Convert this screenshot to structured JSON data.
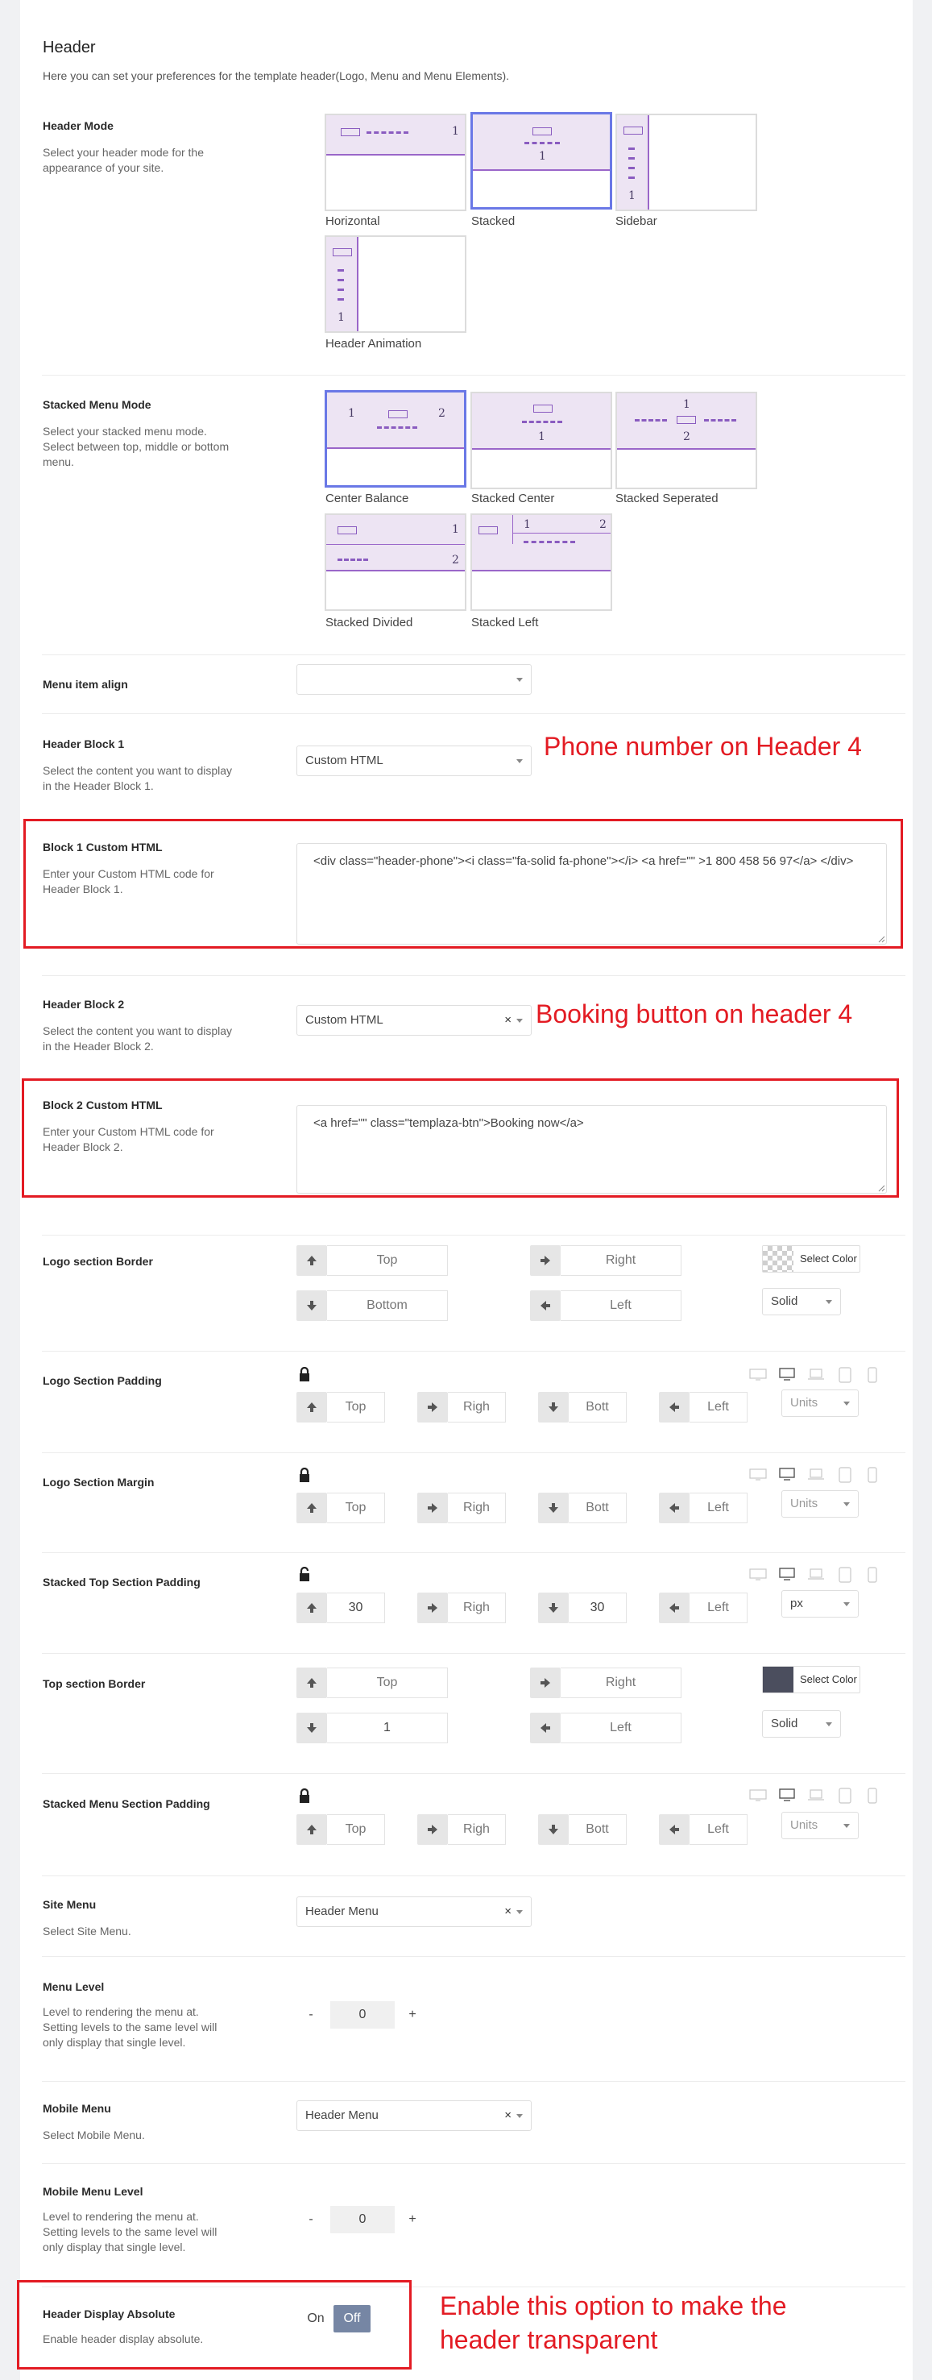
{
  "header": {
    "title": "Header",
    "description": "Here you can set your preferences for the template header(Logo, Menu and Menu Elements)."
  },
  "header_mode": {
    "label": "Header Mode",
    "description": "Select your header mode for the appearance of your site.",
    "options": [
      "Horizontal",
      "Stacked",
      "Sidebar",
      "Header Animation"
    ],
    "selected": "Stacked"
  },
  "stacked_menu_mode": {
    "label": "Stacked Menu Mode",
    "description": "Select your stacked menu mode. Select between top, middle or bottom menu.",
    "options": [
      "Center Balance",
      "Stacked Center",
      "Stacked Seperated",
      "Stacked Divided",
      "Stacked Left"
    ],
    "selected": "Center Balance"
  },
  "tile_numbers": {
    "one": "1",
    "two": "2"
  },
  "menu_item_align": {
    "label": "Menu item align",
    "value": ""
  },
  "header_block_1": {
    "label": "Header Block 1",
    "description": "Select the content you want to display in the Header Block 1.",
    "value": "Custom HTML"
  },
  "block_1_html": {
    "label": "Block 1 Custom HTML",
    "description": "Enter your Custom HTML code for Header Block 1.",
    "value": "<div class=\"header-phone\"><i class=\"fa-solid fa-phone\"></i>  <a href=\"\" >1 800 458 56 97</a> </div>"
  },
  "header_block_2": {
    "label": "Header Block 2",
    "description": "Select the content you want to display in the Header Block 2.",
    "value": "Custom HTML",
    "clear": "×"
  },
  "block_2_html": {
    "label": "Block 2 Custom HTML",
    "description": "Enter your Custom HTML code for Header Block 2.",
    "value": "<a href=\"\" class=\"templaza-btn\">Booking now</a>"
  },
  "annotations": {
    "phone": "Phone number on Header 4",
    "booking": "Booking button on header 4",
    "transparent_line1": "Enable this option to make the",
    "transparent_line2": "header transparent"
  },
  "logo_section_border": {
    "label": "Logo section Border",
    "top": "Top",
    "right": "Right",
    "bottom": "Bottom",
    "left": "Left",
    "color_label": "Select Color",
    "style": "Solid"
  },
  "logo_section_padding": {
    "label": "Logo Section Padding",
    "top": "Top",
    "right": "Righ",
    "bottom": "Bott",
    "left": "Left",
    "units": "Units"
  },
  "logo_section_margin": {
    "label": "Logo Section Margin",
    "top": "Top",
    "right": "Righ",
    "bottom": "Bott",
    "left": "Left",
    "units": "Units"
  },
  "stacked_top_padding": {
    "label": "Stacked Top Section Padding",
    "top": "30",
    "right": "Righ",
    "bottom": "30",
    "left": "Left",
    "units": "px"
  },
  "top_section_border": {
    "label": "Top section Border",
    "top": "Top",
    "right": "Right",
    "bottom": "1",
    "left": "Left",
    "color_label": "Select Color",
    "color": "#4b4e5e",
    "style": "Solid"
  },
  "stacked_menu_padding": {
    "label": "Stacked Menu Section Padding",
    "top": "Top",
    "right": "Righ",
    "bottom": "Bott",
    "left": "Left",
    "units": "Units"
  },
  "site_menu": {
    "label": "Site Menu",
    "description": "Select Site Menu.",
    "value": "Header Menu",
    "clear": "×"
  },
  "menu_level": {
    "label": "Menu Level",
    "description": "Level to rendering the menu at. Setting levels to the same level will only display that single level.",
    "minus": "-",
    "value": "0",
    "plus": "+"
  },
  "mobile_menu": {
    "label": "Mobile Menu",
    "description": "Select Mobile Menu.",
    "value": "Header Menu",
    "clear": "×"
  },
  "mobile_menu_level": {
    "label": "Mobile Menu Level",
    "description": "Level to rendering the menu at. Setting levels to the same level will only display that single level.",
    "minus": "-",
    "value": "0",
    "plus": "+"
  },
  "header_display_absolute": {
    "label": "Header Display Absolute",
    "description": "Enable header display absolute.",
    "on": "On",
    "off": "Off",
    "value": "Off"
  },
  "colors": {
    "accent": "#6a78e6",
    "annotation": "#e31b23",
    "tile_band": "#ede4f3",
    "toggle_off": "#7686a4"
  }
}
